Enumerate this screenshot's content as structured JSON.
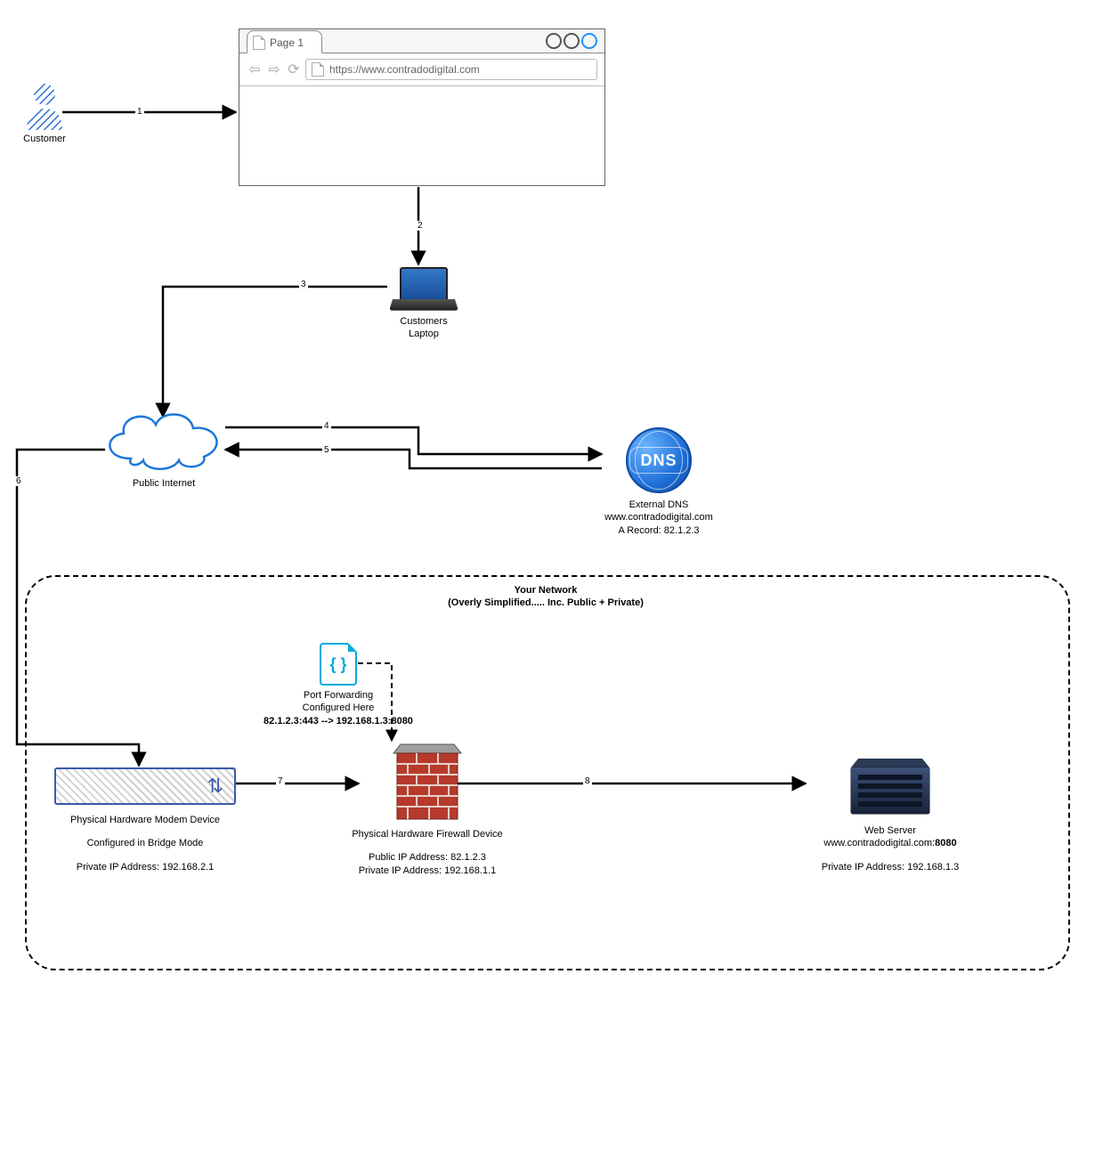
{
  "customer": {
    "label": "Customer"
  },
  "browser": {
    "tab_label": "Page 1",
    "url": "https://www.contradodigital.com"
  },
  "laptop": {
    "label": "Customers Laptop"
  },
  "cloud": {
    "label": "Public Internet"
  },
  "dns": {
    "title": "External DNS",
    "domain": "www.contradodigital.com",
    "record": "A Record: 82.1.2.3",
    "badge": "DNS"
  },
  "network": {
    "title": "Your Network",
    "subtitle": "(Overly Simplified..... Inc. Public + Private)"
  },
  "port_forwarding": {
    "line1": "Port Forwarding",
    "line2": "Configured Here",
    "rule": "82.1.2.3:443 --> 192.168.1.3:8080",
    "icon_glyph": "{ }"
  },
  "modem": {
    "title": "Physical Hardware Modem Device",
    "mode": "Configured in Bridge Mode",
    "ip": "Private IP Address: 192.168.2.1"
  },
  "firewall": {
    "title": "Physical Hardware Firewall Device",
    "public_ip": "Public IP Address: 82.1.2.3",
    "private_ip": "Private IP Address: 192.168.1.1"
  },
  "server": {
    "title": "Web Server",
    "host": "www.contradodigital.com:",
    "port": "8080",
    "ip": "Private IP Address: 192.168.1.3"
  },
  "edges": {
    "e1": "1",
    "e2": "2",
    "e3": "3",
    "e4": "4",
    "e5": "5",
    "e6": "6",
    "e7": "7",
    "e8": "8"
  }
}
